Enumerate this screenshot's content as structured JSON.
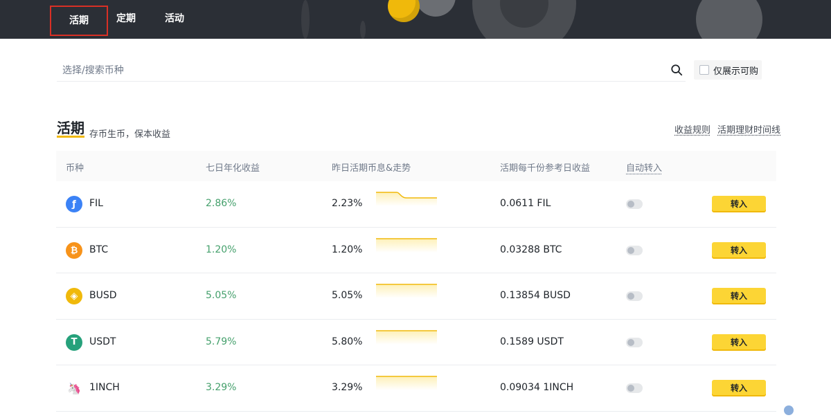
{
  "tabs": [
    {
      "label": "活期"
    },
    {
      "label": "定期"
    },
    {
      "label": "活动"
    }
  ],
  "search": {
    "placeholder": "选择/搜索币种",
    "icon": "search-icon"
  },
  "only_buyable": {
    "label": "仅展示可购",
    "checked": false
  },
  "section": {
    "title": "活期",
    "subtitle": "存币生币，保本收益",
    "links": {
      "rules": "收益规则",
      "timeline": "活期理财时间线"
    }
  },
  "table": {
    "headers": {
      "coin": "币种",
      "apy7d": "七日年化收益",
      "yesterday": "昨日活期币息&走势",
      "per_thousand": "活期每千份参考日收益",
      "auto_transfer": "自动转入"
    },
    "rows": [
      {
        "coin": "FIL",
        "icon_color": "#3b82f6",
        "icon": "fil-icon",
        "apy7d": "2.86%",
        "yesterday": "2.23%",
        "per_thousand": "0.0611 FIL",
        "trend": "down",
        "auto": false,
        "action": "转入"
      },
      {
        "coin": "BTC",
        "icon_color": "#f7931a",
        "icon": "btc-icon",
        "apy7d": "1.20%",
        "yesterday": "1.20%",
        "per_thousand": "0.03288 BTC",
        "trend": "flat",
        "auto": false,
        "action": "转入"
      },
      {
        "coin": "BUSD",
        "icon_color": "#f0b90b",
        "icon": "busd-icon",
        "apy7d": "5.05%",
        "yesterday": "5.05%",
        "per_thousand": "0.13854 BUSD",
        "trend": "flat",
        "auto": false,
        "action": "转入"
      },
      {
        "coin": "USDT",
        "icon_color": "#26a17b",
        "icon": "usdt-icon",
        "apy7d": "5.79%",
        "yesterday": "5.80%",
        "per_thousand": "0.1589 USDT",
        "trend": "flat",
        "auto": false,
        "action": "转入"
      },
      {
        "coin": "1INCH",
        "icon_color": "#1b314f",
        "icon": "1inch-icon",
        "apy7d": "3.29%",
        "yesterday": "3.29%",
        "per_thousand": "0.09034 1INCH",
        "trend": "flat",
        "auto": false,
        "action": "转入"
      }
    ]
  },
  "colors": {
    "accent": "#fcd535",
    "positive": "#45a06c",
    "topbar": "#2b2f36"
  }
}
